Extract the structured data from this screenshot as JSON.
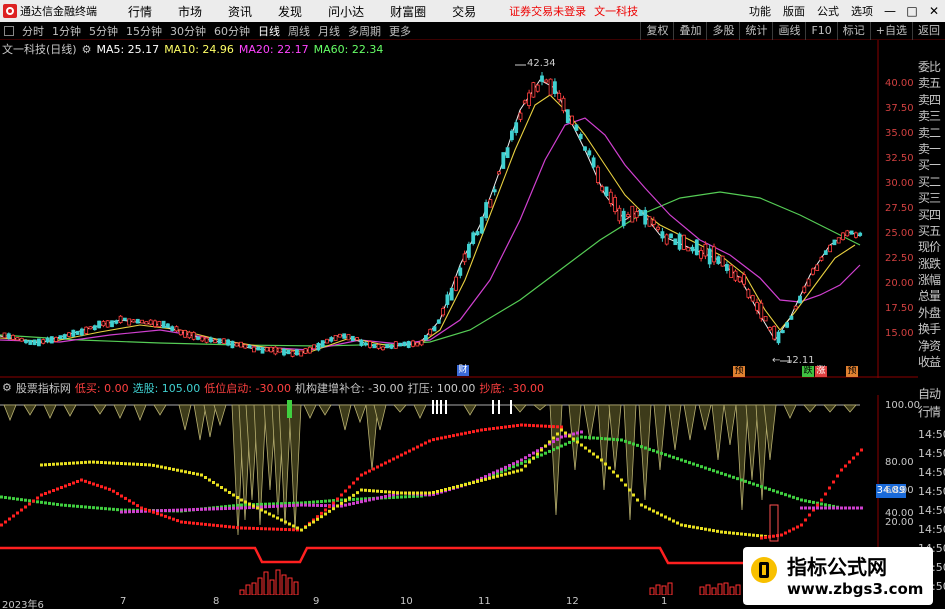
{
  "titlebar": {
    "app_name": "通达信金融终端",
    "menu": [
      "行情",
      "市场",
      "资讯",
      "发现",
      "问小达",
      "财富圈",
      "交易"
    ],
    "login_status": "证券交易未登录",
    "stock_name": "文一科技",
    "right_items": [
      "功能",
      "版面",
      "公式",
      "选项"
    ],
    "window_buttons": [
      "—",
      "□",
      "✕"
    ]
  },
  "periodbar": {
    "periods": [
      "分时",
      "1分钟",
      "5分钟",
      "15分钟",
      "30分钟",
      "60分钟",
      "日线",
      "周线",
      "月线",
      "多周期",
      "更多"
    ],
    "active_period": "日线",
    "right_buttons": [
      "复权",
      "叠加",
      "多股",
      "统计",
      "画线",
      "F10",
      "标记",
      "+自选",
      "返回"
    ]
  },
  "ma_legend": {
    "stock_label": "文一科技(日线)",
    "ma5": "MA5: 25.17",
    "ma10": "MA10: 24.96",
    "ma20": "MA20: 22.17",
    "ma60": "MA60: 22.34",
    "colors": {
      "ma5": "#ffffff",
      "ma10": "#ffff66",
      "ma20": "#ff44ff",
      "ma60": "#66ff66"
    }
  },
  "sidebar": [
    "委比",
    "卖五",
    "卖四",
    "卖三",
    "卖二",
    "卖一",
    "买一",
    "买二",
    "买三",
    "买四",
    "买五",
    "现价",
    "涨跌",
    "涨幅",
    "总量",
    "外盘",
    "换手",
    "净资",
    "收益"
  ],
  "sidebar_lower": [
    "自动",
    "行情"
  ],
  "sidebar_times": [
    "14:50",
    "14:50",
    "14:50",
    "14:50",
    "14:50",
    "14:50",
    "14:50",
    "14:50",
    "14:50"
  ],
  "indicator_legend": {
    "name": "股票指标网",
    "buy": "低买: 0.00",
    "pick": "选股: 105.00",
    "low_start": "低位启动: -30.00",
    "inst": "机构建增补仓: -30.00",
    "press": "打压: 100.00",
    "bottom": "抄底: -30.00"
  },
  "price_axis": [
    "40.00",
    "37.50",
    "35.00",
    "32.50",
    "30.00",
    "27.50",
    "25.00",
    "22.50",
    "20.00",
    "17.50",
    "15.00"
  ],
  "indicator_axis": [
    "100.00",
    "80.00",
    "60.00",
    "40.00",
    "20.00"
  ],
  "current_value": "34.89",
  "annotations": {
    "high": "42.34",
    "low": "12.11",
    "fin_badge": "财",
    "badges": [
      "预",
      "跌",
      "涨",
      "预"
    ]
  },
  "date_axis": [
    "2023年6",
    "7",
    "8",
    "9",
    "10",
    "11",
    "12",
    "1",
    "2"
  ],
  "watermark": {
    "title": "指标公式网",
    "url": "www.zbgs3.com"
  }
}
